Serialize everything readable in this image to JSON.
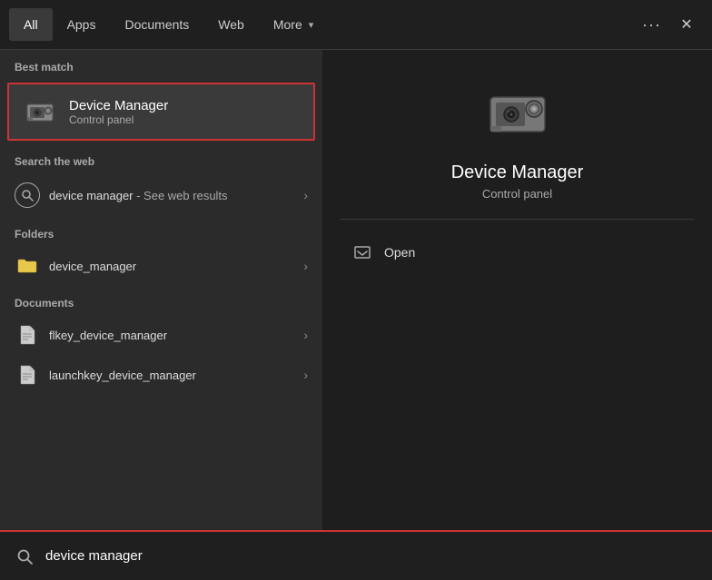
{
  "topnav": {
    "tabs": [
      {
        "id": "all",
        "label": "All",
        "active": true
      },
      {
        "id": "apps",
        "label": "Apps",
        "active": false
      },
      {
        "id": "documents",
        "label": "Documents",
        "active": false
      },
      {
        "id": "web",
        "label": "Web",
        "active": false
      },
      {
        "id": "more",
        "label": "More",
        "active": false
      }
    ],
    "more_chevron": "▾",
    "dots_label": "···",
    "close_label": "✕"
  },
  "left": {
    "best_match_label": "Best match",
    "best_match": {
      "title": "Device Manager",
      "subtitle": "Control panel"
    },
    "web_section_label": "Search the web",
    "web_item": {
      "query": "device manager",
      "suffix": " - See web results"
    },
    "folders_label": "Folders",
    "folders": [
      {
        "name": "device_manager"
      }
    ],
    "documents_label": "Documents",
    "documents": [
      {
        "name": "flkey_device_manager"
      },
      {
        "name": "launchkey_device_manager"
      }
    ]
  },
  "right": {
    "title": "Device Manager",
    "subtitle": "Control panel",
    "actions": [
      {
        "label": "Open"
      }
    ]
  },
  "searchbar": {
    "value": "device manager",
    "placeholder": "Search"
  }
}
